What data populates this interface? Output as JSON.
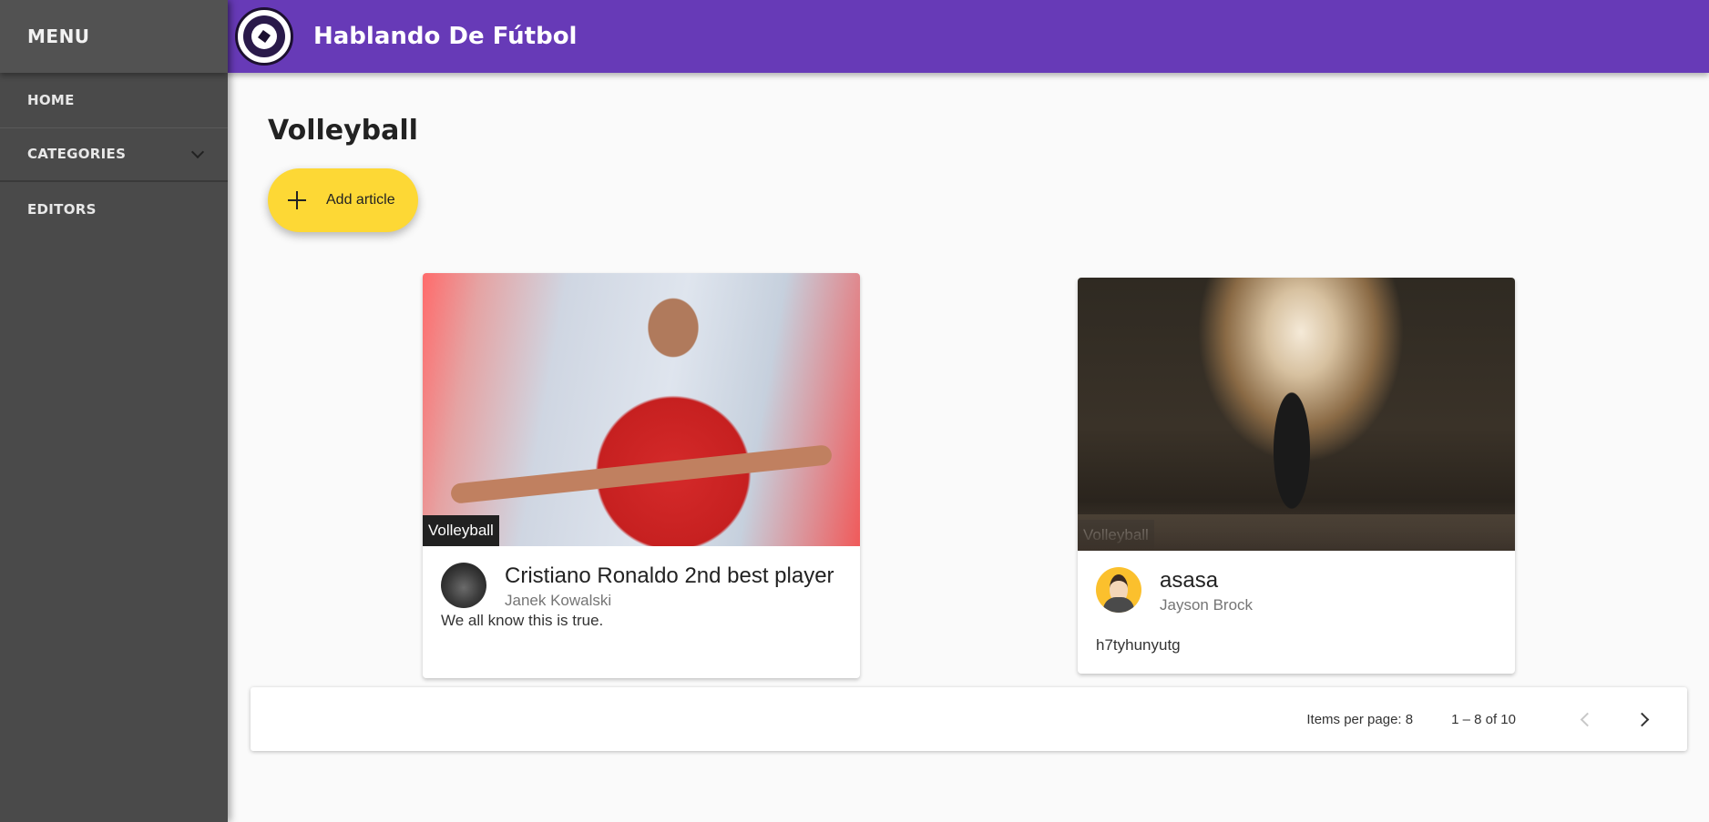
{
  "sidebar": {
    "header": "MENU",
    "items": [
      {
        "label": "HOME"
      },
      {
        "label": "CATEGORIES",
        "icon": "chevron-down-icon"
      },
      {
        "label": "EDITORS"
      }
    ]
  },
  "topbar": {
    "title": "Hablando De Fútbol",
    "logo_icon": "soccer-ball-icon"
  },
  "main": {
    "page_title": "Volleyball",
    "add_button": {
      "label": "Add article",
      "icon": "plus-icon"
    },
    "articles": [
      {
        "category": "Volleyball",
        "title": "Cristiano Ronaldo 2nd best player",
        "author": "Janek Kowalski",
        "text": "We all know this is true."
      },
      {
        "category": "Volleyball",
        "title": "asasa",
        "author": "Jayson Brock",
        "text": "h7tyhunyutg"
      }
    ]
  },
  "paginator": {
    "items_per_page": "Items per page: 8",
    "range": "1 – 8 of 10"
  },
  "colors": {
    "topbar": "#673ab7",
    "sidebar": "#4a4a4a",
    "fab": "#fdd835"
  }
}
